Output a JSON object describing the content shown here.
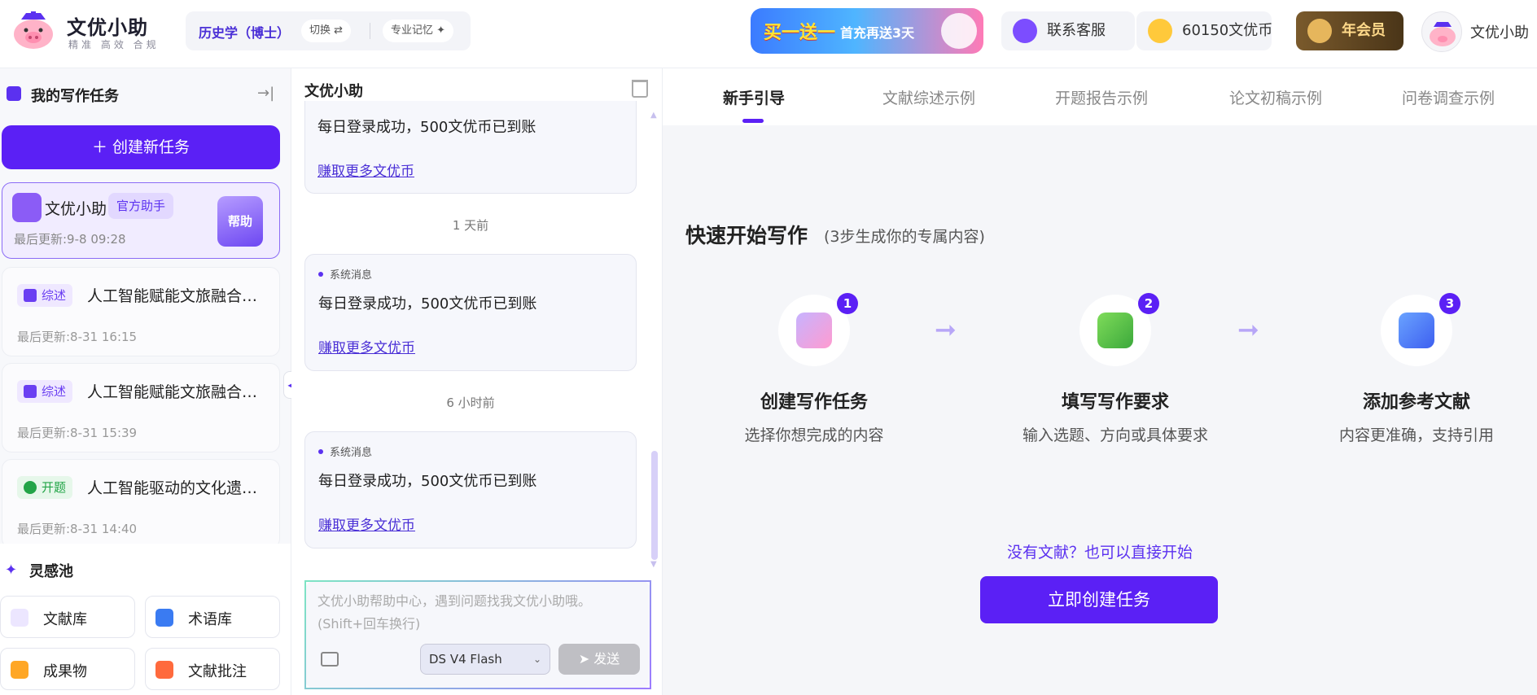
{
  "header": {
    "brand_title": "文优小助",
    "brand_slogan": "精准 高效 合规",
    "subject": "历史学（博士）",
    "switch_label": "切换 ⇄",
    "memory_label": "专业记忆 ✦",
    "promo_main": "买一送一",
    "promo_sub": "首充再送3天",
    "service_label": "联系客服",
    "coins_label": "60150文优币",
    "member_label": "年会员",
    "user_name": "文优小助"
  },
  "sidebar": {
    "title": "我的写作任务",
    "collapse_icon": "→|",
    "create_label": "＋  创建新任务",
    "assistant": {
      "name": "文优小助",
      "badge": "官方助手",
      "time": "最后更新:9-8 09:28",
      "help_label": "帮助"
    },
    "tasks": [
      {
        "tag": "综述",
        "title": "人工智能赋能文旅融合…",
        "time": "最后更新:8-31 16:15"
      },
      {
        "tag": "综述",
        "title": "人工智能赋能文旅融合…",
        "time": "最后更新:8-31 15:39"
      },
      {
        "tag": "开题",
        "title": "人工智能驱动的文化遗…",
        "time": "最后更新:8-31 14:40"
      }
    ],
    "inspire": {
      "title": "灵感池",
      "buttons": [
        "文献库",
        "术语库",
        "成果物",
        "文献批注"
      ]
    }
  },
  "chat": {
    "title": "文优小助",
    "messages": [
      {
        "tag": "",
        "text": "每日登录成功，500文优币已到账",
        "link": "赚取更多文优币"
      },
      {
        "tag": "系统消息",
        "text": "每日登录成功，500文优币已到账",
        "link": "赚取更多文优币"
      },
      {
        "tag": "系统消息",
        "text": "每日登录成功，500文优币已到账",
        "link": "赚取更多文优币"
      }
    ],
    "time_labels": [
      "1 天前",
      "6 小时前"
    ],
    "input_placeholder": "文优小助帮助中心，遇到问题找我文优小助哦。\n(Shift+回车换行)",
    "model": "DS V4 Flash",
    "send_label": "➤  发送"
  },
  "right": {
    "tabs": [
      "新手引导",
      "文献综述示例",
      "开题报告示例",
      "论文初稿示例",
      "问卷调查示例"
    ],
    "quick_title": "快速开始写作",
    "quick_sub": "(3步生成你的专属内容)",
    "steps": [
      {
        "num": "1",
        "title": "创建写作任务",
        "desc": "选择你想完成的内容"
      },
      {
        "num": "2",
        "title": "填写写作要求",
        "desc": "输入选题、方向或具体要求"
      },
      {
        "num": "3",
        "title": "添加参考文献",
        "desc": "内容更准确，支持引用"
      }
    ],
    "no_literature": "没有文献？也可以直接开始",
    "start_button": "立即创建任务"
  },
  "colors": {
    "accent": "#5b20f5",
    "accent_light": "#efe8ff",
    "open_green": "#22a447"
  }
}
